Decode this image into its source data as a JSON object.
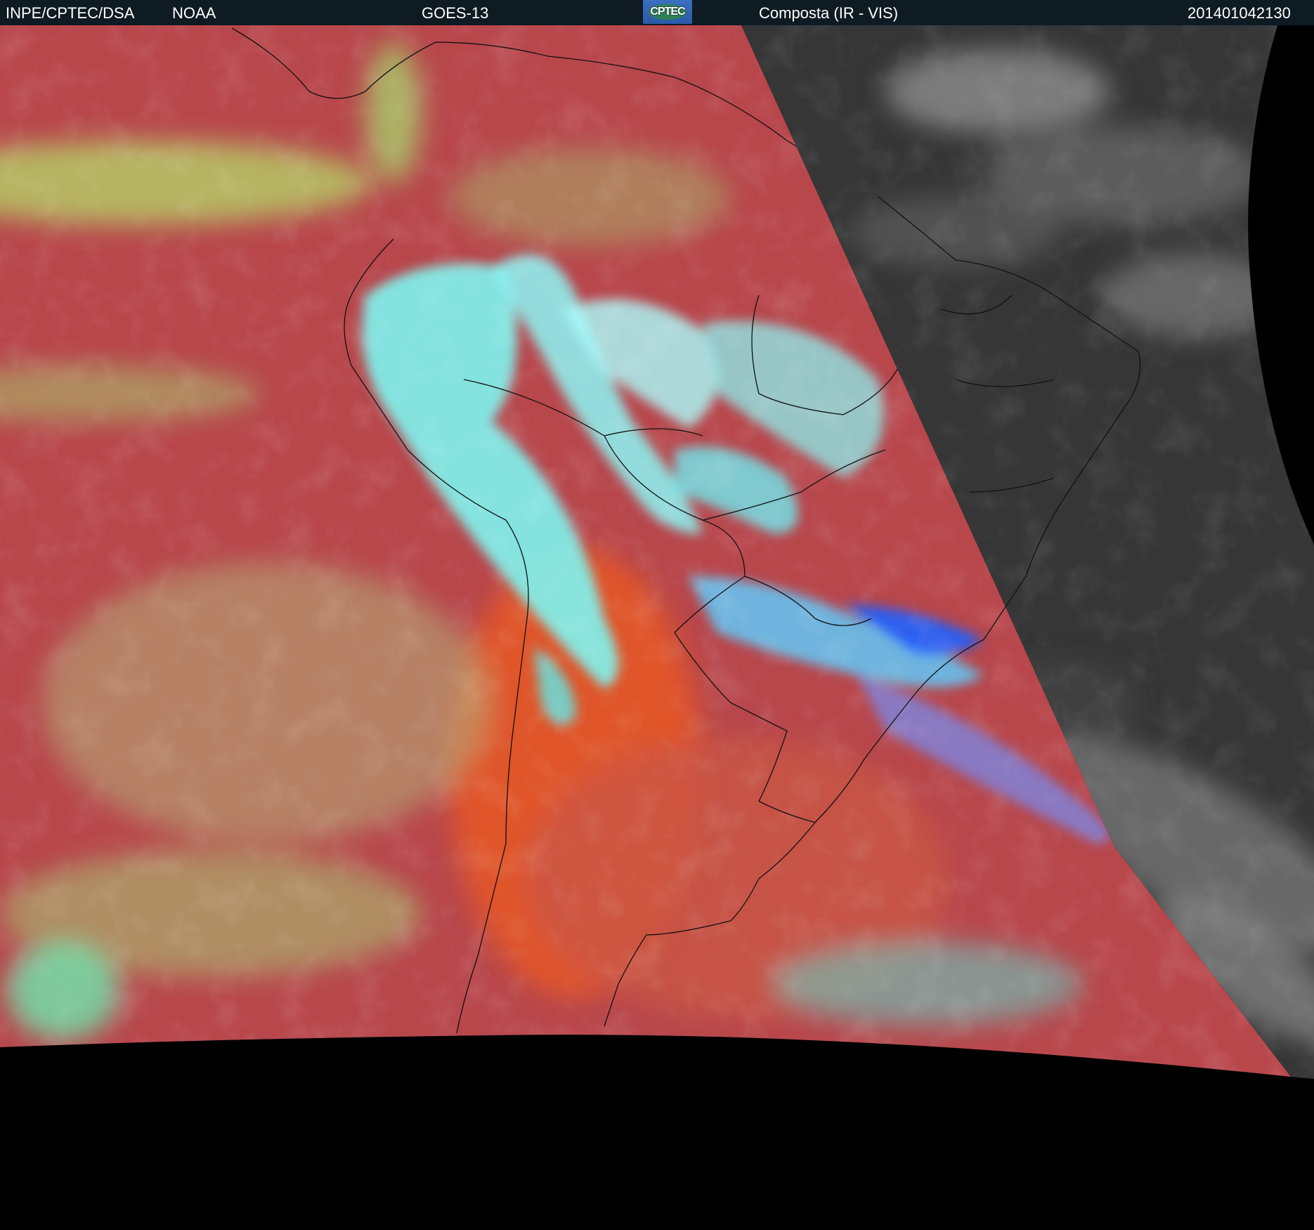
{
  "header": {
    "institution": "INPE/CPTEC/DSA",
    "agency": "NOAA",
    "satellite": "GOES-13",
    "logo_text": "CPTEC",
    "product": "Composta (IR - VIS)",
    "timestamp": "201401042130"
  },
  "colors": {
    "header_bg": "#0f1b22",
    "ir_base": "#b8474c",
    "land_orange": "#d8552a",
    "cloud_cyan": "#5ef0f0",
    "cloud_green": "#a6e070",
    "cloud_blue": "#2060ff",
    "vis_grey": "#3a3a3a"
  }
}
